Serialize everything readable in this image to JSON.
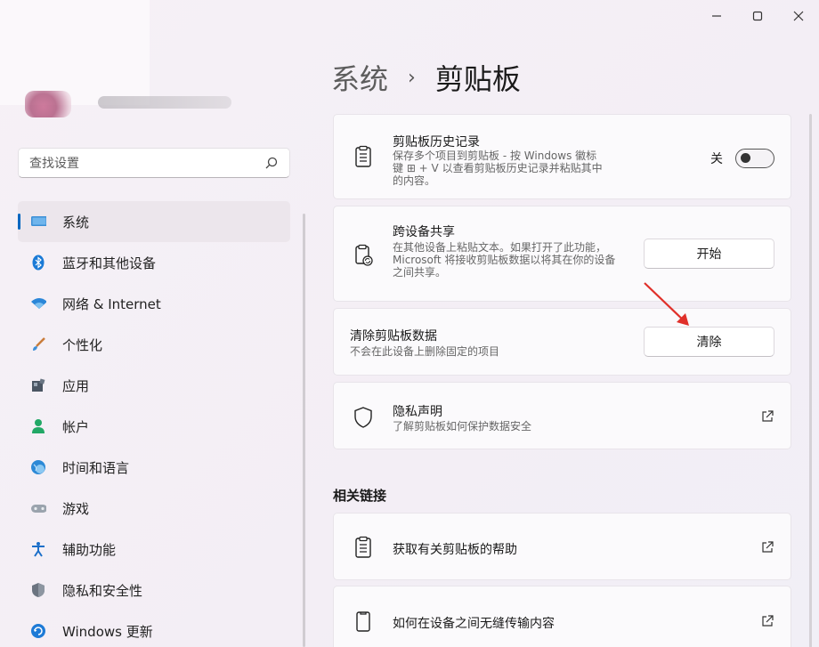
{
  "window": {
    "caption": {
      "minimize": "—",
      "maximize": "☐",
      "close": "✕"
    }
  },
  "search": {
    "placeholder": "查找设置"
  },
  "sidebar": {
    "items": [
      {
        "label": "系统",
        "icon": "monitor-icon",
        "active": true
      },
      {
        "label": "蓝牙和其他设备",
        "icon": "bluetooth-icon"
      },
      {
        "label": "网络 & Internet",
        "icon": "wifi-icon"
      },
      {
        "label": "个性化",
        "icon": "brush-icon"
      },
      {
        "label": "应用",
        "icon": "apps-icon"
      },
      {
        "label": "帐户",
        "icon": "person-icon"
      },
      {
        "label": "时间和语言",
        "icon": "globe-clock-icon"
      },
      {
        "label": "游戏",
        "icon": "gamepad-icon"
      },
      {
        "label": "辅助功能",
        "icon": "accessibility-icon"
      },
      {
        "label": "隐私和安全性",
        "icon": "shield-icon"
      },
      {
        "label": "Windows 更新",
        "icon": "update-icon"
      }
    ]
  },
  "header": {
    "parent": "系统",
    "separator": "›",
    "current": "剪贴板"
  },
  "cards": {
    "history": {
      "title": "剪贴板历史记录",
      "desc": "保存多个项目到剪贴板 - 按 Windows 徽标键 ⊞ + V 以查看剪贴板历史记录并粘贴其中的内容。",
      "toggle_label": "关",
      "toggle_on": false
    },
    "sync": {
      "title": "跨设备共享",
      "desc": "在其他设备上粘贴文本。如果打开了此功能，Microsoft 将接收剪贴板数据以将其在你的设备之间共享。",
      "button": "开始"
    },
    "clear": {
      "title": "清除剪贴板数据",
      "desc": "不会在此设备上删除固定的项目",
      "button": "清除"
    },
    "privacy": {
      "title": "隐私声明",
      "desc": "了解剪贴板如何保护数据安全"
    }
  },
  "related": {
    "label": "相关链接",
    "links": [
      {
        "label": "获取有关剪贴板的帮助"
      },
      {
        "label": "如何在设备之间无缝传输内容"
      }
    ]
  },
  "colors": {
    "accent": "#0067c0",
    "annotation_arrow": "#e0302a"
  }
}
